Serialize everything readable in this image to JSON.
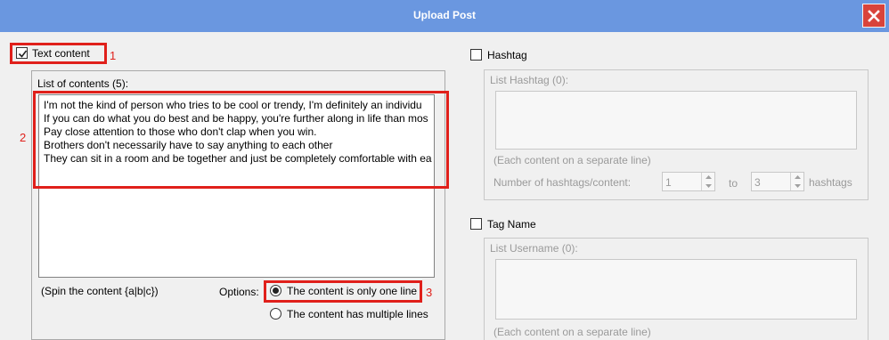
{
  "window": {
    "title": "Upload Post"
  },
  "text_content": {
    "label": "Text content",
    "checked": true,
    "list_label": "List of contents (5):",
    "lines": [
      "I'm not the kind of person who tries to be cool or trendy, I'm definitely an individu",
      "If you can do what you do best and be happy, you're further along in life than mos",
      "Pay close attention to those who don't clap when you win.",
      "Brothers don't necessarily have to say anything to each other",
      "They can sit in a room and be together and just be completely comfortable with ea"
    ],
    "spin_hint": "(Spin the content {a|b|c})",
    "options_label": "Options:",
    "option_one_line": "The content is only one line",
    "option_multi_line": "The content has multiple lines"
  },
  "annotations": {
    "n1": "1",
    "n2": "2",
    "n3": "3"
  },
  "hashtag": {
    "label": "Hashtag",
    "checked": false,
    "list_label": "List Hashtag (0):",
    "hint": "(Each content on a separate line)",
    "count_label": "Number of hashtags/content:",
    "min": "1",
    "to_label": "to",
    "max": "3",
    "unit_label": "hashtags"
  },
  "tag_name": {
    "label": "Tag Name",
    "checked": false,
    "list_label": "List Username (0):",
    "hint": "(Each content on a separate line)"
  },
  "colors": {
    "title_bar": "#6a97e0",
    "close": "#d9433a",
    "annotation": "#e0201b"
  }
}
